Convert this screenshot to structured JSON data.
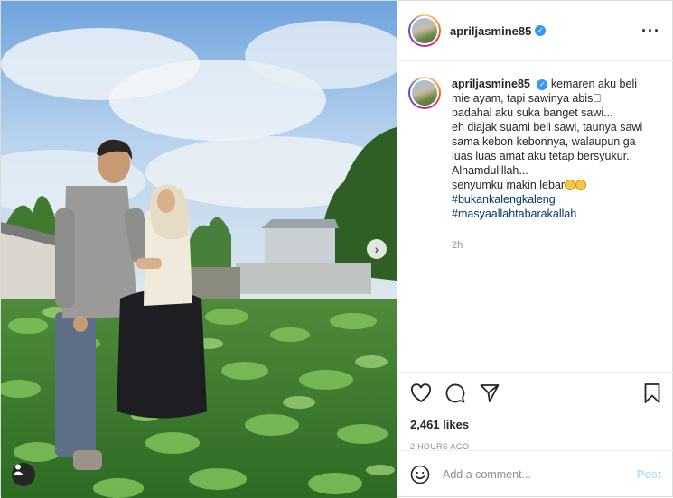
{
  "post": {
    "username": "apriljasmine85",
    "more_icon": "more-icon"
  },
  "caption": {
    "username": "apriljasmine85",
    "lines": [
      "kemaren aku beli",
      "mie ayam, tapi sawinya abis\u0000",
      "padahal aku suka banget sawi...",
      "eh diajak suami beli sawi, taunya sawi",
      "sama kebon kebonnya, walaupun ga",
      "luas luas amat aku tetap bersyukur..",
      "Alhamdulillah...",
      "senyumku makin lebar"
    ],
    "hashtags": [
      "#bukankalengkaleng",
      "#masyaallahtabarakallah"
    ],
    "time_ago": "2h"
  },
  "actions": {
    "likes": "2,461 likes",
    "date": "2 HOURS AGO"
  },
  "comment": {
    "placeholder": "Add a comment...",
    "post_label": "Post"
  },
  "colors": {
    "accent": "#3897f0",
    "post_disabled": "#b2dffc",
    "muted": "#8e8e8e"
  }
}
